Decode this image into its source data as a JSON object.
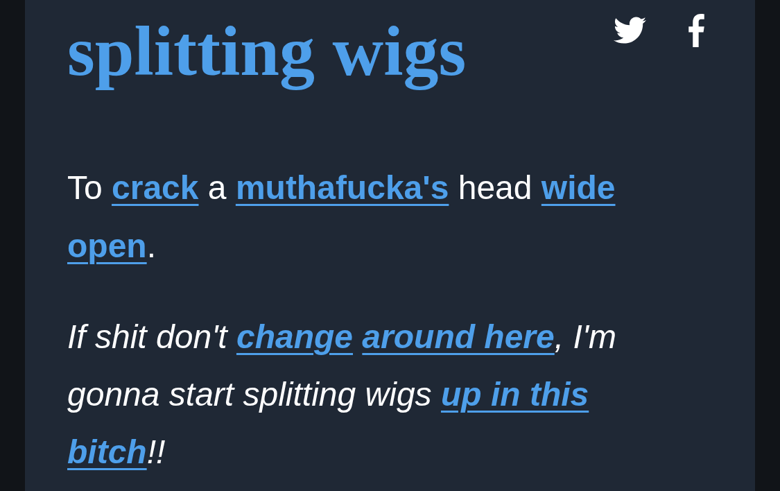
{
  "entry": {
    "title": "splitting wigs",
    "share": [
      {
        "kind": "twitter"
      },
      {
        "kind": "facebook"
      }
    ],
    "definition": [
      {
        "kind": "plain",
        "text": "To "
      },
      {
        "kind": "link",
        "text": "crack"
      },
      {
        "kind": "plain",
        "text": " a "
      },
      {
        "kind": "link",
        "text": "muthafucka's"
      },
      {
        "kind": "plain",
        "text": " head "
      },
      {
        "kind": "link",
        "text": "wide"
      },
      {
        "kind": "link",
        "text": "open",
        "space_before": true
      },
      {
        "kind": "plain",
        "text": "."
      }
    ],
    "example": [
      {
        "kind": "plain",
        "text": "If shit don't "
      },
      {
        "kind": "link",
        "text": "change"
      },
      {
        "kind": "link",
        "text": "around here",
        "space_before": true
      },
      {
        "kind": "plain",
        "text": ", I'm gonna start splitting wigs "
      },
      {
        "kind": "link",
        "text": "up in this"
      },
      {
        "kind": "link",
        "text": "bitch",
        "space_before": true
      },
      {
        "kind": "plain",
        "text": "!!"
      }
    ]
  }
}
